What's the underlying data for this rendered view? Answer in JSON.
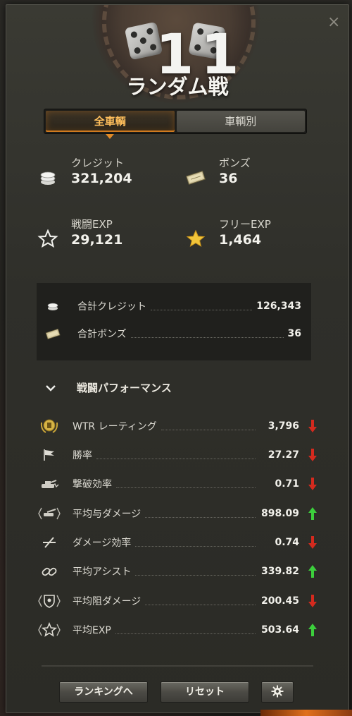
{
  "header": {
    "battle_number": "11",
    "mode_title": "ランダム戦",
    "close": "×"
  },
  "tabs": [
    {
      "label": "全車輌",
      "active": true
    },
    {
      "label": "車輌別",
      "active": false
    }
  ],
  "stats": {
    "credits": {
      "label": "クレジット",
      "value": "321,204",
      "icon": "credits-icon"
    },
    "bonds": {
      "label": "ボンズ",
      "value": "36",
      "icon": "bonds-icon"
    },
    "battle_exp": {
      "label": "戦闘EXP",
      "value": "29,121",
      "icon": "star-outline-icon"
    },
    "free_exp": {
      "label": "フリーEXP",
      "value": "1,464",
      "icon": "star-gold-icon"
    }
  },
  "summary": [
    {
      "label": "合計クレジット",
      "value": "126,343"
    },
    {
      "label": "合計ボンズ",
      "value": "36"
    }
  ],
  "performance": {
    "title": "戦闘パフォーマンス",
    "rows": [
      {
        "label": "WTR レーティング",
        "value": "3,796",
        "trend": "down"
      },
      {
        "label": "勝率",
        "value": "27.27",
        "trend": "down"
      },
      {
        "label": "撃破効率",
        "value": "0.71",
        "trend": "down"
      },
      {
        "label": "平均与ダメージ",
        "value": "898.09",
        "trend": "up"
      },
      {
        "label": "ダメージ効率",
        "value": "0.74",
        "trend": "down"
      },
      {
        "label": "平均アシスト",
        "value": "339.82",
        "trend": "up"
      },
      {
        "label": "平均阻ダメージ",
        "value": "200.45",
        "trend": "down"
      },
      {
        "label": "平均EXP",
        "value": "503.64",
        "trend": "up"
      }
    ]
  },
  "buttons": {
    "ranking": "ランキングへ",
    "reset": "リセット"
  },
  "colors": {
    "accent": "#ffbf5c",
    "trend_up": "#3ccf3c",
    "trend_down": "#d42a1e"
  }
}
